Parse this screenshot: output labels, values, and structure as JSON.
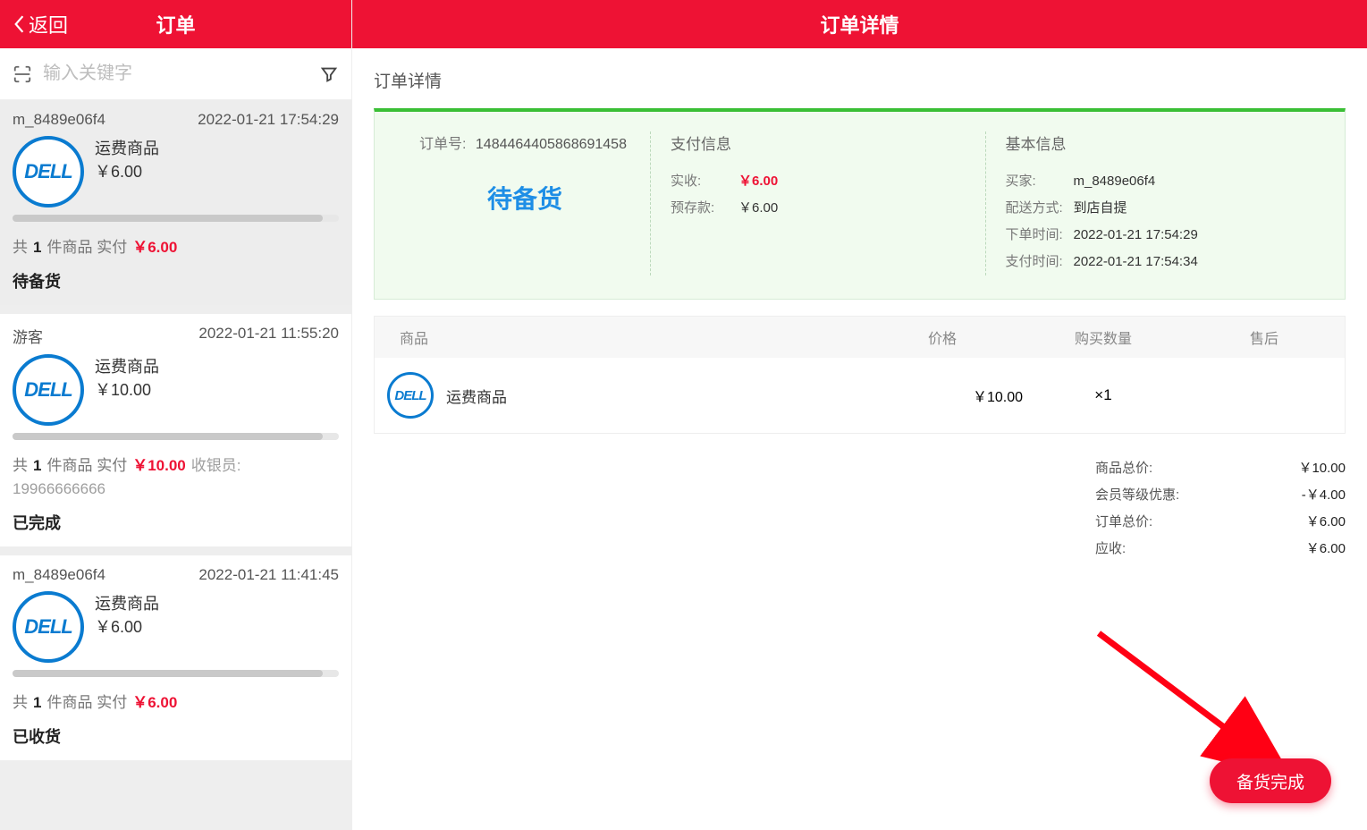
{
  "left": {
    "back": "返回",
    "title": "订单",
    "search_placeholder": "输入关键字",
    "orders": [
      {
        "user": "m_8489e06f4",
        "time": "2022-01-21 17:54:29",
        "item_name": "运费商品",
        "item_price": "￥6.00",
        "count": "1",
        "count_prefix": "共",
        "count_suffix": "件商品 实付",
        "paid": "￥6.00",
        "cashier_label": "",
        "cashier_val": "",
        "status": "待备货",
        "progress_pct": 95
      },
      {
        "user": "游客",
        "time": "2022-01-21 11:55:20",
        "item_name": "运费商品",
        "item_price": "￥10.00",
        "count": "1",
        "count_prefix": "共",
        "count_suffix": "件商品 实付",
        "paid": "￥10.00",
        "cashier_label": "收银员:",
        "cashier_val": "19966666666",
        "status": "已完成",
        "progress_pct": 95
      },
      {
        "user": "m_8489e06f4",
        "time": "2022-01-21 11:41:45",
        "item_name": "运费商品",
        "item_price": "￥6.00",
        "count": "1",
        "count_prefix": "共",
        "count_suffix": "件商品 实付",
        "paid": "￥6.00",
        "cashier_label": "",
        "cashier_val": "",
        "status": "已收货",
        "progress_pct": 95
      }
    ]
  },
  "right": {
    "header": "订单详情",
    "section": "订单详情",
    "order_no_label": "订单号:",
    "order_no": "1484464405868691458",
    "big_status": "待备货",
    "pay_head": "支付信息",
    "pay_received_label": "实收:",
    "pay_received": "￥6.00",
    "pay_deposit_label": "预存款:",
    "pay_deposit": "￥6.00",
    "basic_head": "基本信息",
    "buyer_label": "买家:",
    "buyer": "m_8489e06f4",
    "shipping_label": "配送方式:",
    "shipping": "到店自提",
    "order_time_label": "下单时间:",
    "order_time": "2022-01-21 17:54:29",
    "pay_time_label": "支付时间:",
    "pay_time": "2022-01-21 17:54:34",
    "th_name": "商品",
    "th_price": "价格",
    "th_qty": "购买数量",
    "th_after": "售后",
    "item_name": "运费商品",
    "item_price": "￥10.00",
    "item_qty": "×1",
    "tot_item_label": "商品总价:",
    "tot_item": "￥10.00",
    "tot_disc_label": "会员等级优惠:",
    "tot_disc": "-￥4.00",
    "tot_order_label": "订单总价:",
    "tot_order": "￥6.00",
    "tot_due_label": "应收:",
    "tot_due": "￥6.00",
    "fab": "备货完成"
  },
  "logo_text": "DELL"
}
